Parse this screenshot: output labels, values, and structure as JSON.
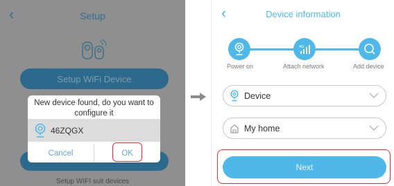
{
  "left_screen": {
    "header": {
      "back_icon": "chevron-left-icon",
      "title": "Setup"
    },
    "setup_wifi_button": "Setup WiFi Device",
    "dialog": {
      "message": "New device found, do you want to configure it",
      "device_icon": "camera-icon",
      "device_name": "46ZQGX",
      "cancel_label": "Cancel",
      "ok_label": "OK"
    },
    "footer_text": "Setup WIFI suit devices"
  },
  "transition_arrow_icon": "arrow-right-icon",
  "right_screen": {
    "header": {
      "back_icon": "chevron-left-icon",
      "title": "Device information"
    },
    "steps": [
      {
        "label": "Power on",
        "icon": "camera-icon"
      },
      {
        "label": "Attach network",
        "icon": "4g-signal-icon"
      },
      {
        "label": "Add device",
        "icon": "search-icon"
      }
    ],
    "device_select": {
      "icon": "camera-icon",
      "value": "Device"
    },
    "home_select": {
      "icon": "home-icon",
      "value": "My home"
    },
    "next_label": "Next"
  },
  "colors": {
    "accent": "#4fb8e8",
    "overlay_accent": "#2c6a8d",
    "highlight_ring": "#d8343a"
  }
}
